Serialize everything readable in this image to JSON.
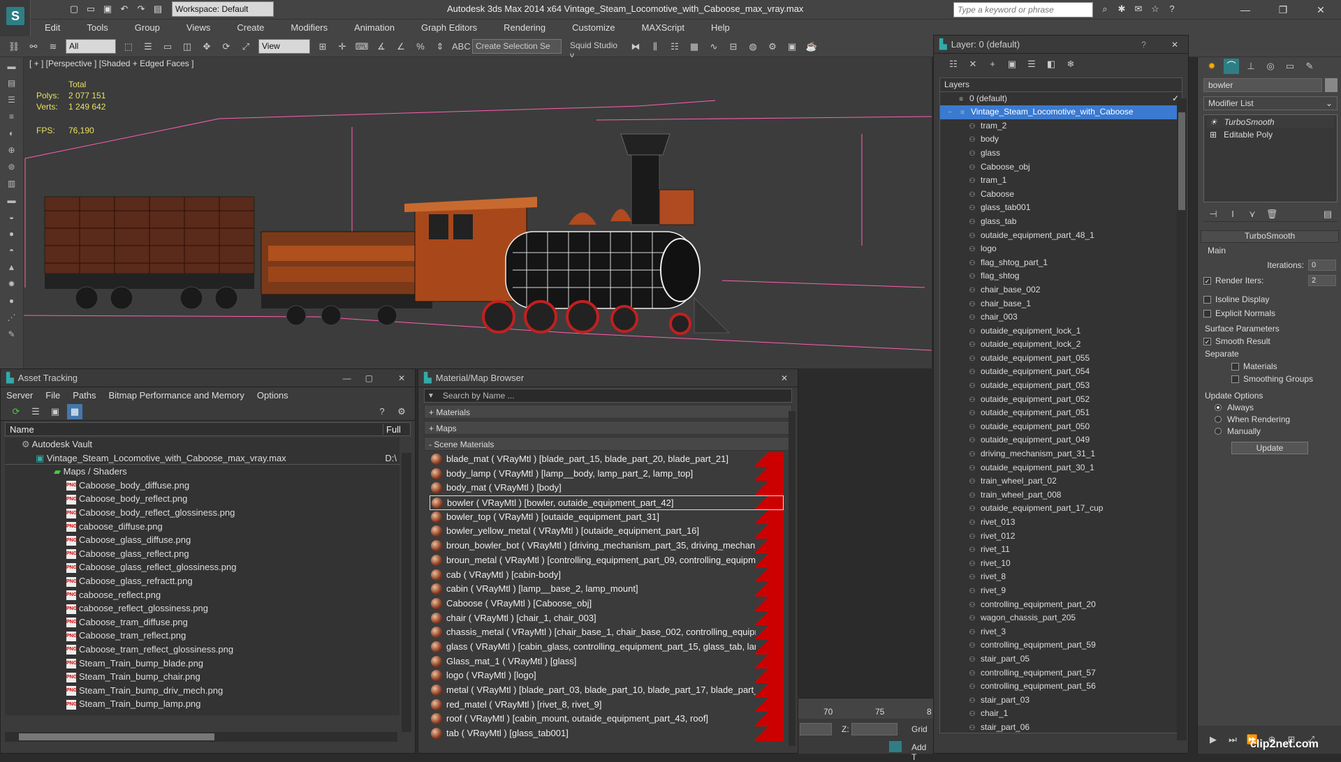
{
  "app": {
    "title": "Autodesk 3ds Max  2014 x64    Vintage_Steam_Locomotive_with_Caboose_max_vray.max",
    "workspace": "Workspace: Default",
    "search_placeholder": "Type a keyword or phrase"
  },
  "menu": [
    "Edit",
    "Tools",
    "Group",
    "Views",
    "Create",
    "Modifiers",
    "Animation",
    "Graph Editors",
    "Rendering",
    "Customize",
    "MAXScript",
    "Help"
  ],
  "toolbar": {
    "filter": "All",
    "view": "View",
    "selection_set": "Create Selection Se",
    "studio": "Squid Studio v"
  },
  "viewport": {
    "label": "[ + ] [Perspective ] [Shaded + Edged Faces ]",
    "total_label": "Total",
    "polys_label": "Polys:",
    "polys": "2 077 151",
    "verts_label": "Verts:",
    "verts": "1 249 642",
    "fps_label": "FPS:",
    "fps": "76,190"
  },
  "asset": {
    "title": "Asset Tracking",
    "menu": [
      "Server",
      "File",
      "Paths",
      "Bitmap Performance and Memory",
      "Options"
    ],
    "col_name": "Name",
    "col_full": "Full",
    "root": "Autodesk Vault",
    "file": "Vintage_Steam_Locomotive_with_Caboose_max_vray.max",
    "file_path": "D:\\",
    "folder": "Maps / Shaders",
    "maps": [
      "Caboose_body_diffuse.png",
      "Caboose_body_reflect.png",
      "Caboose_body_reflect_glossiness.png",
      "caboose_diffuse.png",
      "Caboose_glass_diffuse.png",
      "Caboose_glass_reflect.png",
      "Caboose_glass_reflect_glossiness.png",
      "Caboose_glass_refractt.png",
      "caboose_reflect.png",
      "caboose_reflect_glossiness.png",
      "Caboose_tram_diffuse.png",
      "Caboose_tram_reflect.png",
      "Caboose_tram_reflect_glossiness.png",
      "Steam_Train_bump_blade.png",
      "Steam_Train_bump_chair.png",
      "Steam_Train_bump_driv_mech.png",
      "Steam_Train_bump_lamp.png"
    ]
  },
  "matbrowser": {
    "title": "Material/Map Browser",
    "search_placeholder": "Search by Name ...",
    "groups": [
      "+ Materials",
      "+ Maps",
      "- Scene Materials"
    ],
    "materials": [
      "blade_mat  ( VRayMtl ) [blade_part_15, blade_part_20, blade_part_21]",
      "body_lamp  ( VRayMtl ) [lamp__body, lamp_part_2, lamp_top]",
      "body_mat  ( VRayMtl ) [body]",
      "bowler  ( VRayMtl ) [bowler, outaide_equipment_part_42]",
      "bowler_top  ( VRayMtl ) [outaide_equipment_part_31]",
      "bowler_yellow_metal  ( VRayMtl ) [outaide_equipment_part_16]",
      "broun_bowler_bot  ( VRayMtl ) [driving_mechanism_part_35, driving_mechanis...",
      "broun_metal  ( VRayMtl ) [controlling_equipment_part_09, controlling_equipmen...",
      "cab  ( VRayMtl ) [cabin-body]",
      "cabin  ( VRayMtl ) [lamp__base_2, lamp_mount]",
      "Caboose  ( VRayMtl ) [Caboose_obj]",
      "chair  ( VRayMtl ) [chair_1, chair_003]",
      "chassis_metal  ( VRayMtl ) [chair_base_1, chair_base_002, controlling_equipme...",
      "glass  ( VRayMtl ) [cabin_glass, controlling_equipment_part_15, glass_tab, lamp...",
      "Glass_mat_1  ( VRayMtl ) [glass]",
      "logo  ( VRayMtl ) [logo]",
      "metal  ( VRayMtl ) [blade_part_03, blade_part_10, blade_part_17, blade_part_2...",
      "red_matel  ( VRayMtl ) [rivet_8, rivet_9]",
      "roof  ( VRayMtl ) [cabin_mount, outaide_equipment_part_43, roof]",
      "tab  ( VRayMtl ) [glass_tab001]"
    ],
    "selected_index": 3
  },
  "layers": {
    "title": "Layer: 0 (default)",
    "header": "Layers",
    "default_layer": "0 (default)",
    "group": "Vintage_Steam_Locomotive_with_Caboose",
    "items": [
      "tram_2",
      "body",
      "glass",
      "Caboose_obj",
      "tram_1",
      "Caboose",
      "glass_tab001",
      "glass_tab",
      "outaide_equipment_part_48_1",
      "logo",
      "flag_shtog_part_1",
      "flag_shtog",
      "chair_base_002",
      "chair_base_1",
      "chair_003",
      "outaide_equipment_lock_1",
      "outaide_equipment_lock_2",
      "outaide_equipment_part_055",
      "outaide_equipment_part_054",
      "outaide_equipment_part_053",
      "outaide_equipment_part_052",
      "outaide_equipment_part_051",
      "outaide_equipment_part_050",
      "outaide_equipment_part_049",
      "driving_mechanism_part_31_1",
      "outaide_equipment_part_30_1",
      "train_wheel_part_02",
      "train_wheel_part_008",
      "outaide_equipment_part_17_cup",
      "rivet_013",
      "rivet_012",
      "rivet_11",
      "rivet_10",
      "rivet_8",
      "rivet_9",
      "controlling_equipment_part_20",
      "wagon_chassis_part_205",
      "rivet_3",
      "controlling_equipment_part_59",
      "stair_part_05",
      "controlling_equipment_part_57",
      "controlling_equipment_part_56",
      "stair_part_03",
      "chair_1",
      "stair_part_06"
    ]
  },
  "cmdpanel": {
    "object_name": "bowler",
    "modifier_list": "Modifier List",
    "stack": [
      "TurboSmooth",
      "Editable Poly"
    ],
    "rollout": "TurboSmooth",
    "main": "Main",
    "iterations_label": "Iterations:",
    "iterations": "0",
    "render_iters_label": "Render Iters:",
    "render_iters": "2",
    "isoline": "Isoline Display",
    "explicit": "Explicit Normals",
    "surface_params": "Surface Parameters",
    "smooth_result": "Smooth Result",
    "separate": "Separate",
    "materials": "Materials",
    "smoothing_groups": "Smoothing Groups",
    "update_options": "Update Options",
    "always": "Always",
    "when_rendering": "When Rendering",
    "manually": "Manually",
    "update": "Update"
  },
  "timeline": {
    "ticks": [
      "70",
      "75",
      "8"
    ],
    "z_label": "Z:",
    "grid": "Grid",
    "add": "Add T"
  },
  "watermark": "clip2net.com"
}
